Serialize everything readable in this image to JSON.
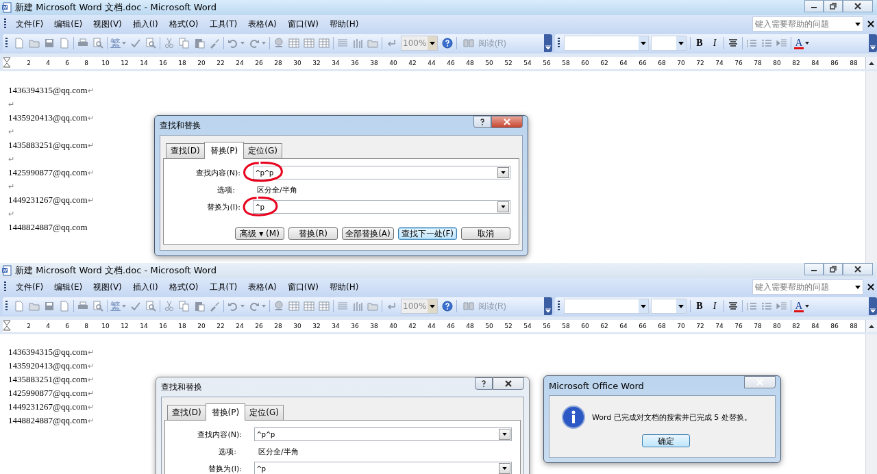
{
  "windows": [
    {
      "title": "新建 Microsoft Word 文档.doc - Microsoft Word",
      "active": true,
      "menu": [
        "文件(F)",
        "编辑(E)",
        "视图(V)",
        "插入(I)",
        "格式(O)",
        "工具(T)",
        "表格(A)",
        "窗口(W)",
        "帮助(H)"
      ],
      "help_placeholder": "键入需要帮助的问题",
      "toolbar": {
        "convert": "繁",
        "zoom": "100%",
        "read": "阅读(R)",
        "bold": "B",
        "italic": "I",
        "font_color": "A"
      },
      "ruler": [
        "2",
        "4",
        "6",
        "8",
        "10",
        "12",
        "14",
        "16",
        "18",
        "20",
        "22",
        "24",
        "26",
        "28",
        "30",
        "32",
        "34",
        "36",
        "38",
        "40",
        "42",
        "44",
        "46",
        "48",
        "50",
        "52",
        "54",
        "56",
        "58",
        "60",
        "62",
        "64",
        "66",
        "68",
        "70",
        "72",
        "74",
        "76",
        "78",
        "80",
        "82",
        "84",
        "86",
        "88"
      ],
      "lines": [
        {
          "text": "1436394315@qq.com",
          "mark": "↵"
        },
        {
          "mark": "↵"
        },
        {
          "text": "1435920413@qq.com",
          "mark": "↵"
        },
        {
          "mark": "↵"
        },
        {
          "text": "1435883251@qq.com",
          "mark": "↵"
        },
        {
          "mark": "↵"
        },
        {
          "text": "1425990877@qq.com",
          "mark": "↵"
        },
        {
          "mark": "↵"
        },
        {
          "text": "1449231267@qq.com",
          "mark": "↵"
        },
        {
          "mark": "↵"
        },
        {
          "text": "1448824887@qq.com"
        }
      ],
      "dialogs": [
        {
          "kind": "find_replace",
          "title": "查找和替换",
          "active": true,
          "tabs": [
            {
              "label": "查找(D)",
              "selected": false
            },
            {
              "label": "替换(P)",
              "selected": true
            },
            {
              "label": "定位(G)",
              "selected": false
            }
          ],
          "find": {
            "label": "查找内容(N):",
            "value": "^p^p",
            "circled": true
          },
          "options": {
            "label": "选项:",
            "value": "区分全/半角"
          },
          "replace": {
            "label": "替换为(I):",
            "value": "^p",
            "circled": true
          },
          "buttons": [
            {
              "label": "高级 ▾ (M)",
              "default": false
            },
            {
              "label": "替换(R)",
              "default": false
            },
            {
              "label": "全部替换(A)",
              "default": false
            },
            {
              "label": "查找下一处(F)",
              "default": true
            },
            {
              "label": "取消",
              "default": false
            }
          ]
        }
      ]
    },
    {
      "title": "新建 Microsoft Word 文档.doc - Microsoft Word",
      "active": false,
      "menu": [
        "文件(F)",
        "编辑(E)",
        "视图(V)",
        "插入(I)",
        "格式(O)",
        "工具(T)",
        "表格(A)",
        "窗口(W)",
        "帮助(H)"
      ],
      "help_placeholder": "键入需要帮助的问题",
      "toolbar": {
        "convert": "繁",
        "zoom": "100%",
        "read": "阅读(R)",
        "bold": "B",
        "italic": "I",
        "font_color": "A"
      },
      "ruler": [
        "2",
        "4",
        "6",
        "8",
        "10",
        "12",
        "14",
        "16",
        "18",
        "20",
        "22",
        "24",
        "26",
        "28",
        "30",
        "32",
        "34",
        "36",
        "38",
        "40",
        "42",
        "44",
        "46",
        "48",
        "50",
        "52",
        "54",
        "56",
        "58",
        "60",
        "62",
        "64",
        "66",
        "68",
        "70",
        "72",
        "74",
        "76",
        "78",
        "80",
        "82",
        "84",
        "86",
        "88"
      ],
      "lines": [
        {
          "text": "1436394315@qq.com",
          "mark": "↵"
        },
        {
          "text": "1435920413@qq.com",
          "mark": "↵"
        },
        {
          "text": "1435883251@qq.com",
          "mark": "↵"
        },
        {
          "text": "1425990877@qq.com",
          "mark": "↵"
        },
        {
          "text": "1449231267@qq.com",
          "mark": "↵"
        },
        {
          "text": "1448824887@qq.com",
          "mark": "↵"
        }
      ],
      "dialogs": [
        {
          "kind": "find_replace",
          "title": "查找和替换",
          "active": false,
          "tabs": [
            {
              "label": "查找(D)",
              "selected": false
            },
            {
              "label": "替换(P)",
              "selected": true
            },
            {
              "label": "定位(G)",
              "selected": false
            }
          ],
          "find": {
            "label": "查找内容(N):",
            "value": "^p^p",
            "circled": false
          },
          "options": {
            "label": "选项:",
            "value": "区分全/半角"
          },
          "replace": {
            "label": "替换为(I):",
            "value": "^p",
            "circled": false
          }
        },
        {
          "kind": "message",
          "title": "Microsoft Office Word",
          "active": true,
          "message": "Word 已完成对文档的搜索并已完成 5 处替换。",
          "button": "确定"
        }
      ]
    }
  ]
}
